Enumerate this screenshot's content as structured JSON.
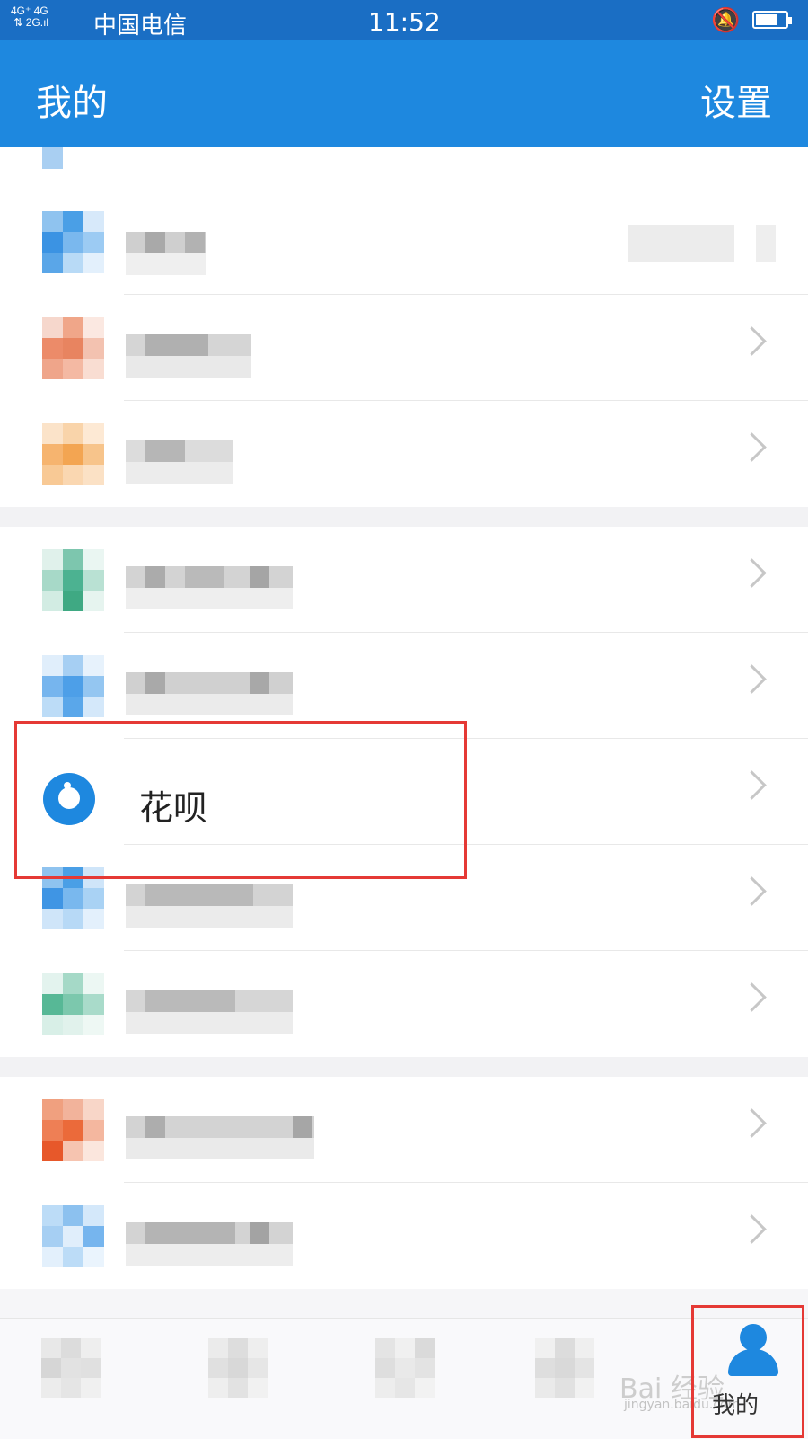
{
  "status_bar": {
    "signal_text": "4G⁺ 4G 2G",
    "carrier": "中国电信",
    "time": "11:52",
    "icons": [
      "signal-icon",
      "bell-muted-icon",
      "battery-icon"
    ]
  },
  "header": {
    "title": "我的",
    "settings": "设置"
  },
  "highlighted_item": {
    "label": "花呗",
    "icon": "huabei-icon"
  },
  "tab_bar": {
    "active_label": "我的",
    "active_icon": "person-icon"
  },
  "watermark": {
    "text": "Bai 经验",
    "sub": "jingyan.baidu.com"
  },
  "colors": {
    "header": "#1e88df",
    "highlight": "#e53935"
  }
}
